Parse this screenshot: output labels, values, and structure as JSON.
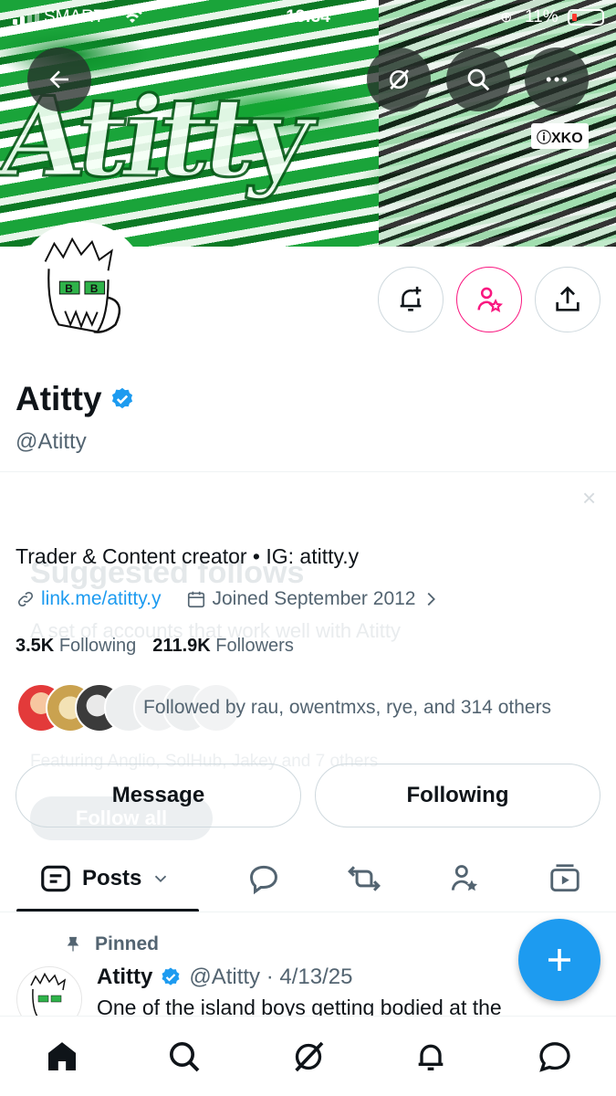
{
  "status_bar": {
    "carrier": "SMART",
    "time": "13:34",
    "battery": "11%"
  },
  "banner": {
    "art_text": "Atitty",
    "social_tag": "ⓘXKO"
  },
  "profile": {
    "name": "Atitty",
    "handle": "@Atitty",
    "bio": "Trader & Content creator • IG: atitty.y",
    "link": "link.me/atitty.y",
    "joined": "Joined September 2012",
    "following_count": "3.5K",
    "following_label": "Following",
    "followers_count": "211.9K",
    "followers_label": "Followers",
    "followed_by": "Followed by rau, owentmxs, rye, and 314 others"
  },
  "suggested_ghost": {
    "title": "Suggested follows",
    "subtitle": "A set of accounts that work well with Atitty",
    "featuring": "Featuring Anglio, SolHub, Jakey and 7 others",
    "follow_all": "Follow all",
    "close": "×"
  },
  "buttons": {
    "message": "Message",
    "following": "Following"
  },
  "tabs": {
    "posts": "Posts"
  },
  "pinned_post": {
    "pinned_label": "Pinned",
    "author": "Atitty",
    "handle_date": "@Atitty · 4/13/25",
    "text": "One of the island boys getting bodied at the"
  },
  "icons": {
    "back": "arrow-left-icon",
    "grok": "grok-icon",
    "search": "search-icon",
    "more": "more-icon",
    "notify": "bell-plus-icon",
    "subscribe": "person-star-icon",
    "share": "share-icon",
    "posts_tab": "posts-tab-icon",
    "replies": "reply-icon",
    "reposts": "repost-icon",
    "highlights": "person-star-icon",
    "media": "media-icon",
    "compose": "plus-icon",
    "home": "home-icon",
    "explore": "search-icon",
    "grok_nav": "grok-icon",
    "notifications": "bell-icon",
    "messages": "message-icon"
  },
  "colors": {
    "accent": "#1d9bf0",
    "pink": "#f91880",
    "text": "#0f1419",
    "muted": "#536471"
  }
}
